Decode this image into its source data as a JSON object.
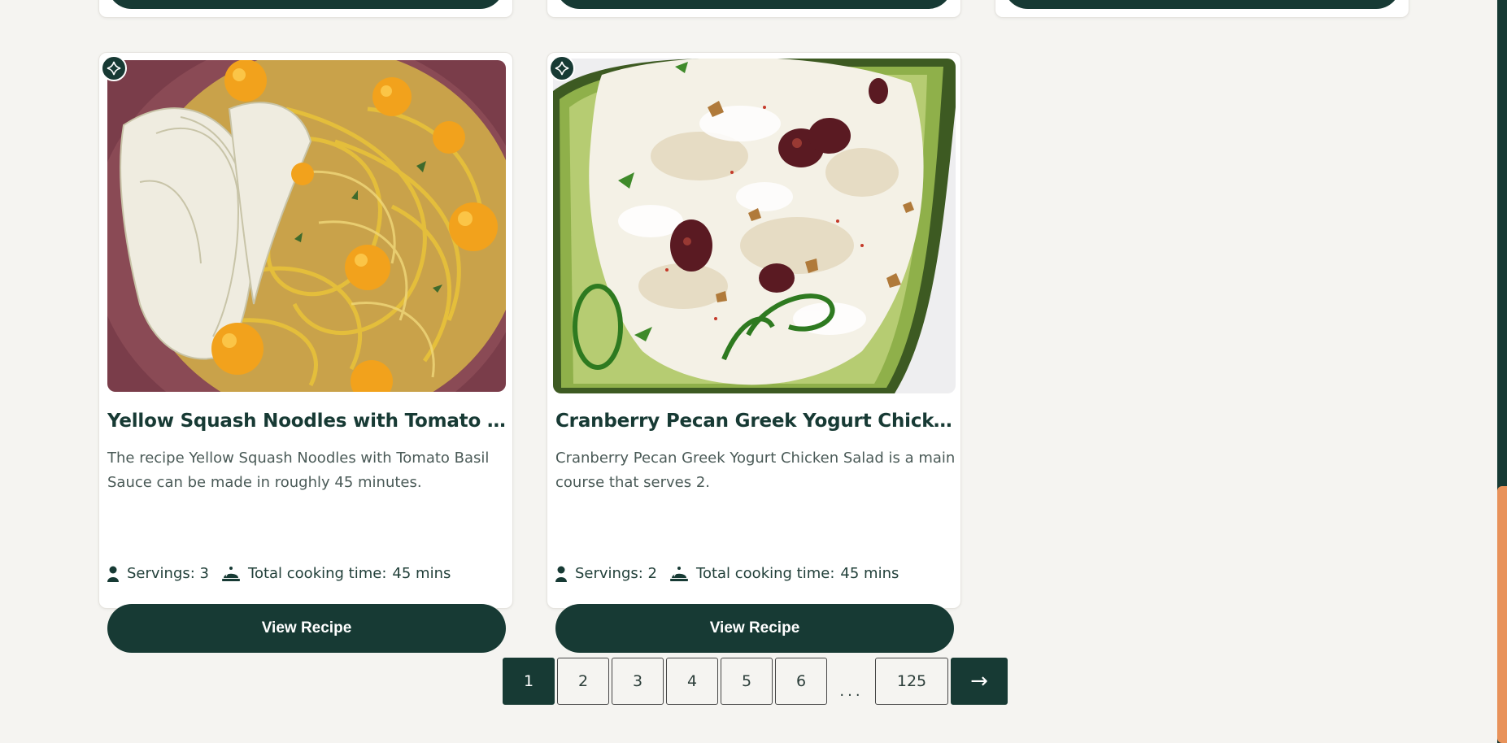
{
  "recipes": [
    {
      "title": "Yellow Squash Noodles with Tomato Basil Sauce",
      "description": "The recipe Yellow Squash Noodles with Tomato Basil Sauce can be made in roughly 45 minutes.",
      "servings_label": "Servings: 3",
      "time_label": "Total cooking time:",
      "time_value": "45 mins",
      "button_label": "View Recipe",
      "image_icon": "squash-noodles-photo"
    },
    {
      "title": "Cranberry Pecan Greek Yogurt Chicken Salad",
      "description": "Cranberry Pecan Greek Yogurt Chicken Salad is a main course that serves 2.",
      "servings_label": "Servings: 2",
      "time_label": "Total cooking time:",
      "time_value": "45 mins",
      "button_label": "View Recipe",
      "image_icon": "chicken-salad-avocado-photo"
    }
  ],
  "pagination": {
    "pages": [
      "1",
      "2",
      "3",
      "4",
      "5",
      "6"
    ],
    "ellipsis": "...",
    "last": "125",
    "next": "→",
    "active": "1"
  },
  "icons": {
    "add": "plus-circle-icon",
    "servings": "person-icon",
    "time": "cloche-icon"
  },
  "colors": {
    "primary": "#173a34",
    "background": "#f5f4f1",
    "accent": "#e8925a"
  }
}
